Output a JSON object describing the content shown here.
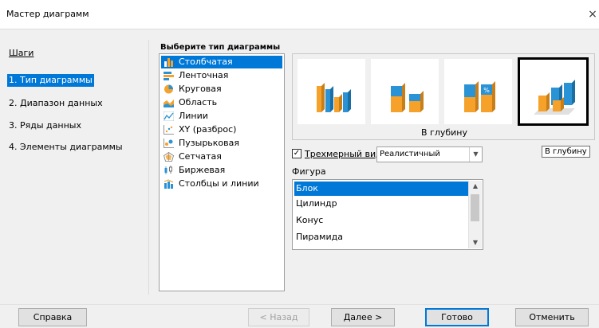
{
  "window": {
    "title": "Мастер диаграмм",
    "close_glyph": "×"
  },
  "steps": {
    "heading": "Шаги",
    "items": [
      {
        "label": "1. Тип диаграммы",
        "active": true
      },
      {
        "label": "2. Диапазон данных",
        "active": false
      },
      {
        "label": "3. Ряды данных",
        "active": false
      },
      {
        "label": "4. Элементы диаграммы",
        "active": false
      }
    ]
  },
  "chart_type": {
    "heading": "Выберите тип диаграммы",
    "items": [
      {
        "label": "Столбчатая",
        "icon": "column-chart-icon",
        "selected": true
      },
      {
        "label": "Ленточная",
        "icon": "bar-chart-icon",
        "selected": false
      },
      {
        "label": "Круговая",
        "icon": "pie-chart-icon",
        "selected": false
      },
      {
        "label": "Область",
        "icon": "area-chart-icon",
        "selected": false
      },
      {
        "label": "Линии",
        "icon": "line-chart-icon",
        "selected": false
      },
      {
        "label": "XY (разброс)",
        "icon": "xy-scatter-icon",
        "selected": false
      },
      {
        "label": "Пузырьковая",
        "icon": "bubble-chart-icon",
        "selected": false
      },
      {
        "label": "Сетчатая",
        "icon": "net-chart-icon",
        "selected": false
      },
      {
        "label": "Биржевая",
        "icon": "stock-chart-icon",
        "selected": false
      },
      {
        "label": "Столбцы и линии",
        "icon": "column-line-chart-icon",
        "selected": false
      }
    ]
  },
  "variants": {
    "caption": "В глубину",
    "selected_index": 3,
    "items": [
      "normal-3d-column-icon",
      "stacked-3d-column-icon",
      "percent-stacked-3d-column-icon",
      "deep-3d-column-icon"
    ],
    "tooltip": "В глубину",
    "percent_glyph": "%"
  },
  "options": {
    "three_d_label": "Трехмерный вид",
    "three_d_checked": true,
    "check_glyph": "✓",
    "look_value": "Реалистичный",
    "dropdown_glyph": "▼"
  },
  "shape": {
    "label": "Фигура",
    "items": [
      {
        "label": "Блок",
        "selected": true
      },
      {
        "label": "Цилиндр",
        "selected": false
      },
      {
        "label": "Конус",
        "selected": false
      },
      {
        "label": "Пирамида",
        "selected": false
      }
    ],
    "scroll_up": "▲",
    "scroll_down": "▼"
  },
  "buttons": {
    "help": "Справка",
    "back": "< Назад",
    "next": "Далее >",
    "finish": "Готово",
    "cancel": "Отменить"
  },
  "colors": {
    "accent": "#0078d7",
    "orange": "#f5a12a",
    "blue": "#2a93d6"
  }
}
